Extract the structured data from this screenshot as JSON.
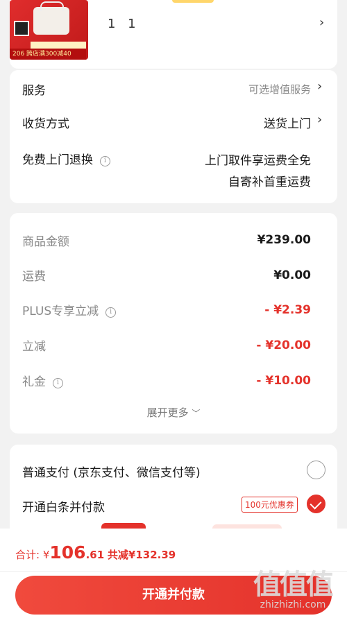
{
  "product": {
    "thumb_badge": "206 跨店满300减40",
    "quantity": "1 1"
  },
  "service_card": {
    "service_label": "服务",
    "service_value": "可选增值服务",
    "delivery_label": "收货方式",
    "delivery_value": "送货上门",
    "return_label": "免费上门退换",
    "return_value_line1": "上门取件享运费全免",
    "return_value_line2": "自寄补首重运费"
  },
  "summary": {
    "goods_label": "商品金额",
    "goods_value": "¥239.00",
    "shipping_label": "运费",
    "shipping_value": "¥0.00",
    "plus_label": "PLUS专享立减",
    "plus_value": "- ¥2.39",
    "discount_label": "立减",
    "discount_value": "- ¥20.00",
    "gift_label": "礼金",
    "gift_value": "- ¥10.00",
    "expand_label": "展开更多"
  },
  "payment": {
    "normal_label": "普通支付 (京东支付、微信支付等)",
    "baitiao_label": "开通白条并付款",
    "coupon_label": "100元优惠券"
  },
  "bottom_bar": {
    "total_prefix": "合计: ¥",
    "total_int": "106",
    "total_dec": ".61",
    "saved": "共减¥132.39",
    "pay_button": "开通并付款"
  },
  "watermark": {
    "logo": "值值值",
    "url": "zhizhizhi.com"
  },
  "colors": {
    "accent": "#e4322b",
    "background": "#f2f2f2"
  }
}
